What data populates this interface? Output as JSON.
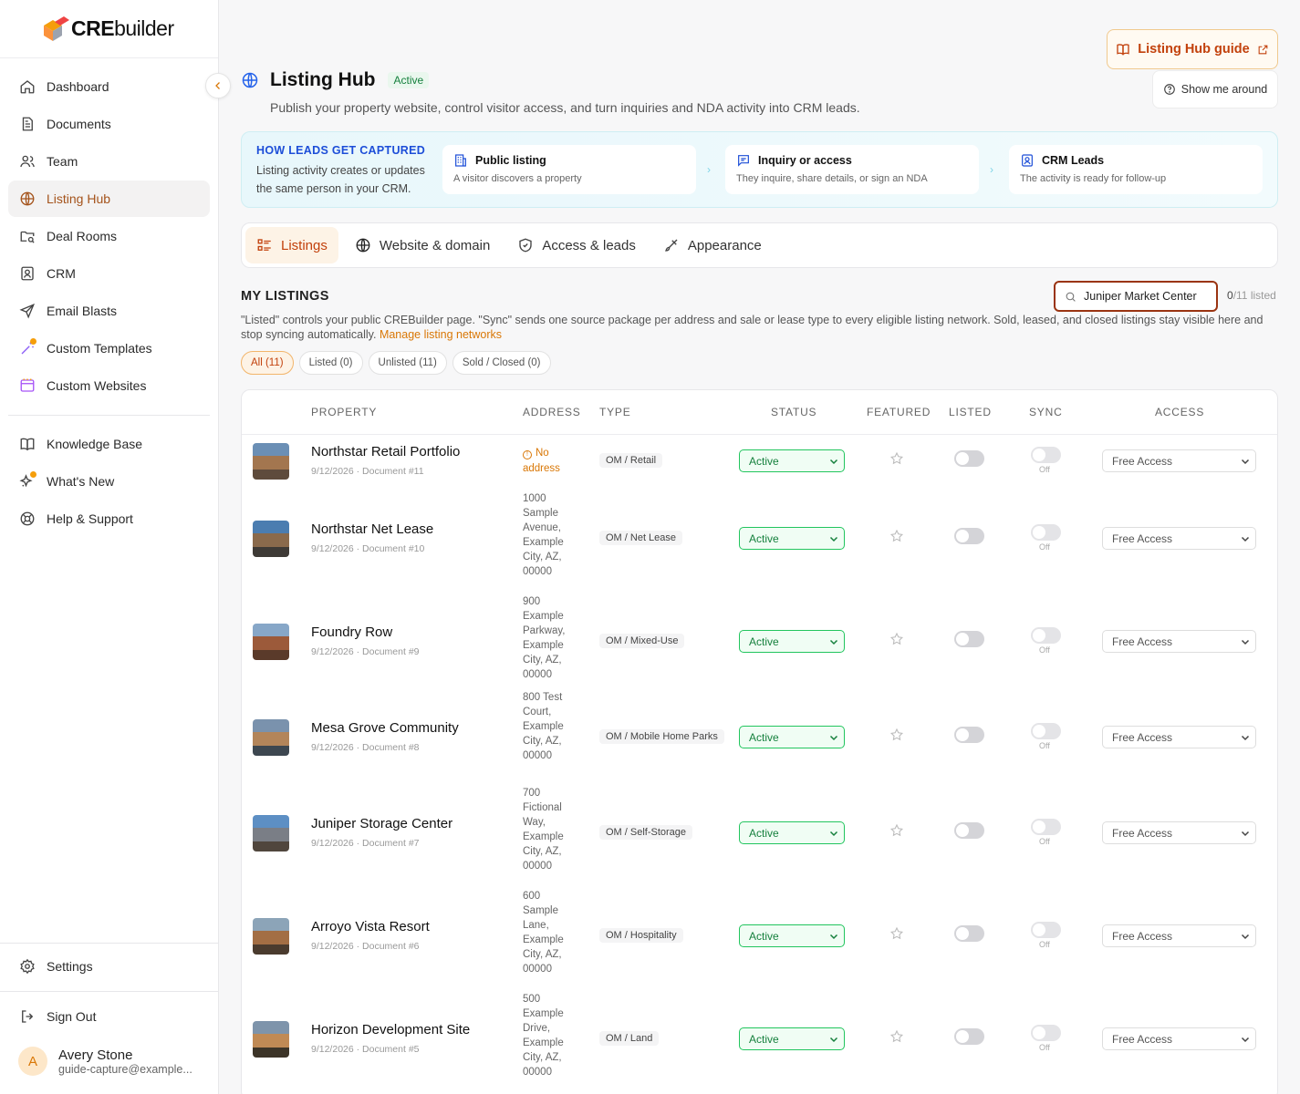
{
  "brand": {
    "name_bold": "CRE",
    "name_light": "builder"
  },
  "sidebar": {
    "items": [
      {
        "label": "Dashboard",
        "icon": "home-icon"
      },
      {
        "label": "Documents",
        "icon": "document-icon"
      },
      {
        "label": "Team",
        "icon": "users-icon"
      },
      {
        "label": "Listing Hub",
        "icon": "globe-icon",
        "active": true
      },
      {
        "label": "Deal Rooms",
        "icon": "folder-search-icon"
      },
      {
        "label": "CRM",
        "icon": "contact-icon"
      },
      {
        "label": "Email Blasts",
        "icon": "send-icon"
      },
      {
        "label": "Custom Templates",
        "icon": "wand-icon",
        "dot": true
      },
      {
        "label": "Custom Websites",
        "icon": "browser-icon"
      }
    ],
    "secondary": [
      {
        "label": "Knowledge Base",
        "icon": "book-icon"
      },
      {
        "label": "What's New",
        "icon": "sparkle-icon",
        "dot": true
      },
      {
        "label": "Help & Support",
        "icon": "lifebuoy-icon"
      }
    ],
    "settings_label": "Settings",
    "signout_label": "Sign Out",
    "user": {
      "initial": "A",
      "name": "Avery Stone",
      "email": "guide-capture@example..."
    }
  },
  "header": {
    "title": "Listing Hub",
    "badge": "Active",
    "subtitle": "Publish your property website, control visitor access, and turn inquiries and NDA activity into CRM leads.",
    "guide_label": "Listing Hub guide",
    "tour_label": "Show me around"
  },
  "leads": {
    "title": "HOW LEADS GET CAPTURED",
    "desc": "Listing activity creates or updates the same person in your CRM.",
    "steps": [
      {
        "title": "Public listing",
        "desc": "A visitor discovers a property"
      },
      {
        "title": "Inquiry or access",
        "desc": "They inquire, share details, or sign an NDA"
      },
      {
        "title": "CRM Leads",
        "desc": "The activity is ready for follow-up"
      }
    ]
  },
  "tabs": [
    "Listings",
    "Website & domain",
    "Access & leads",
    "Appearance"
  ],
  "listings": {
    "title": "MY LISTINGS",
    "search_value": "Juniper Market Center",
    "count_listed": "0",
    "count_rest": "/11 listed",
    "desc": "\"Listed\" controls your public CREBuilder page. \"Sync\" sends one source package per address and sale or lease type to every eligible listing network. Sold, leased, and closed listings stay visible here and stop syncing automatically.",
    "desc_link": "Manage listing networks",
    "filters": [
      "All (11)",
      "Listed (0)",
      "Unlisted (11)",
      "Sold / Closed (0)"
    ],
    "columns": [
      "PROPERTY",
      "ADDRESS",
      "TYPE",
      "STATUS",
      "FEATURED",
      "LISTED",
      "SYNC",
      "ACCESS"
    ],
    "sync_off_label": "Off",
    "no_address_label": "No address",
    "rows": [
      {
        "name": "Northstar Retail Portfolio",
        "meta": "9/12/2026 · Document #11",
        "address": "",
        "type": "OM / Retail",
        "status": "Active",
        "access": "Free Access"
      },
      {
        "name": "Northstar Net Lease",
        "meta": "9/12/2026 · Document #10",
        "address": "1000 Sample Avenue, Example City, AZ, 00000",
        "type": "OM / Net Lease",
        "status": "Active",
        "access": "Free Access"
      },
      {
        "name": "Foundry Row",
        "meta": "9/12/2026 · Document #9",
        "address": "900 Example Parkway, Example City, AZ, 00000",
        "type": "OM / Mixed-Use",
        "status": "Active",
        "access": "Free Access"
      },
      {
        "name": "Mesa Grove Community",
        "meta": "9/12/2026 · Document #8",
        "address": "800 Test Court, Example City, AZ, 00000",
        "type": "OM / Mobile Home Parks",
        "status": "Active",
        "access": "Free Access"
      },
      {
        "name": "Juniper Storage Center",
        "meta": "9/12/2026 · Document #7",
        "address": "700 Fictional Way, Example City, AZ, 00000",
        "type": "OM / Self-Storage",
        "status": "Active",
        "access": "Free Access"
      },
      {
        "name": "Arroyo Vista Resort",
        "meta": "9/12/2026 · Document #6",
        "address": "600 Sample Lane, Example City, AZ, 00000",
        "type": "OM / Hospitality",
        "status": "Active",
        "access": "Free Access"
      },
      {
        "name": "Horizon Development Site",
        "meta": "9/12/2026 · Document #5",
        "address": "500 Example Drive, Example City, AZ, 00000",
        "type": "OM / Land",
        "status": "Active",
        "access": "Free Access"
      }
    ]
  }
}
